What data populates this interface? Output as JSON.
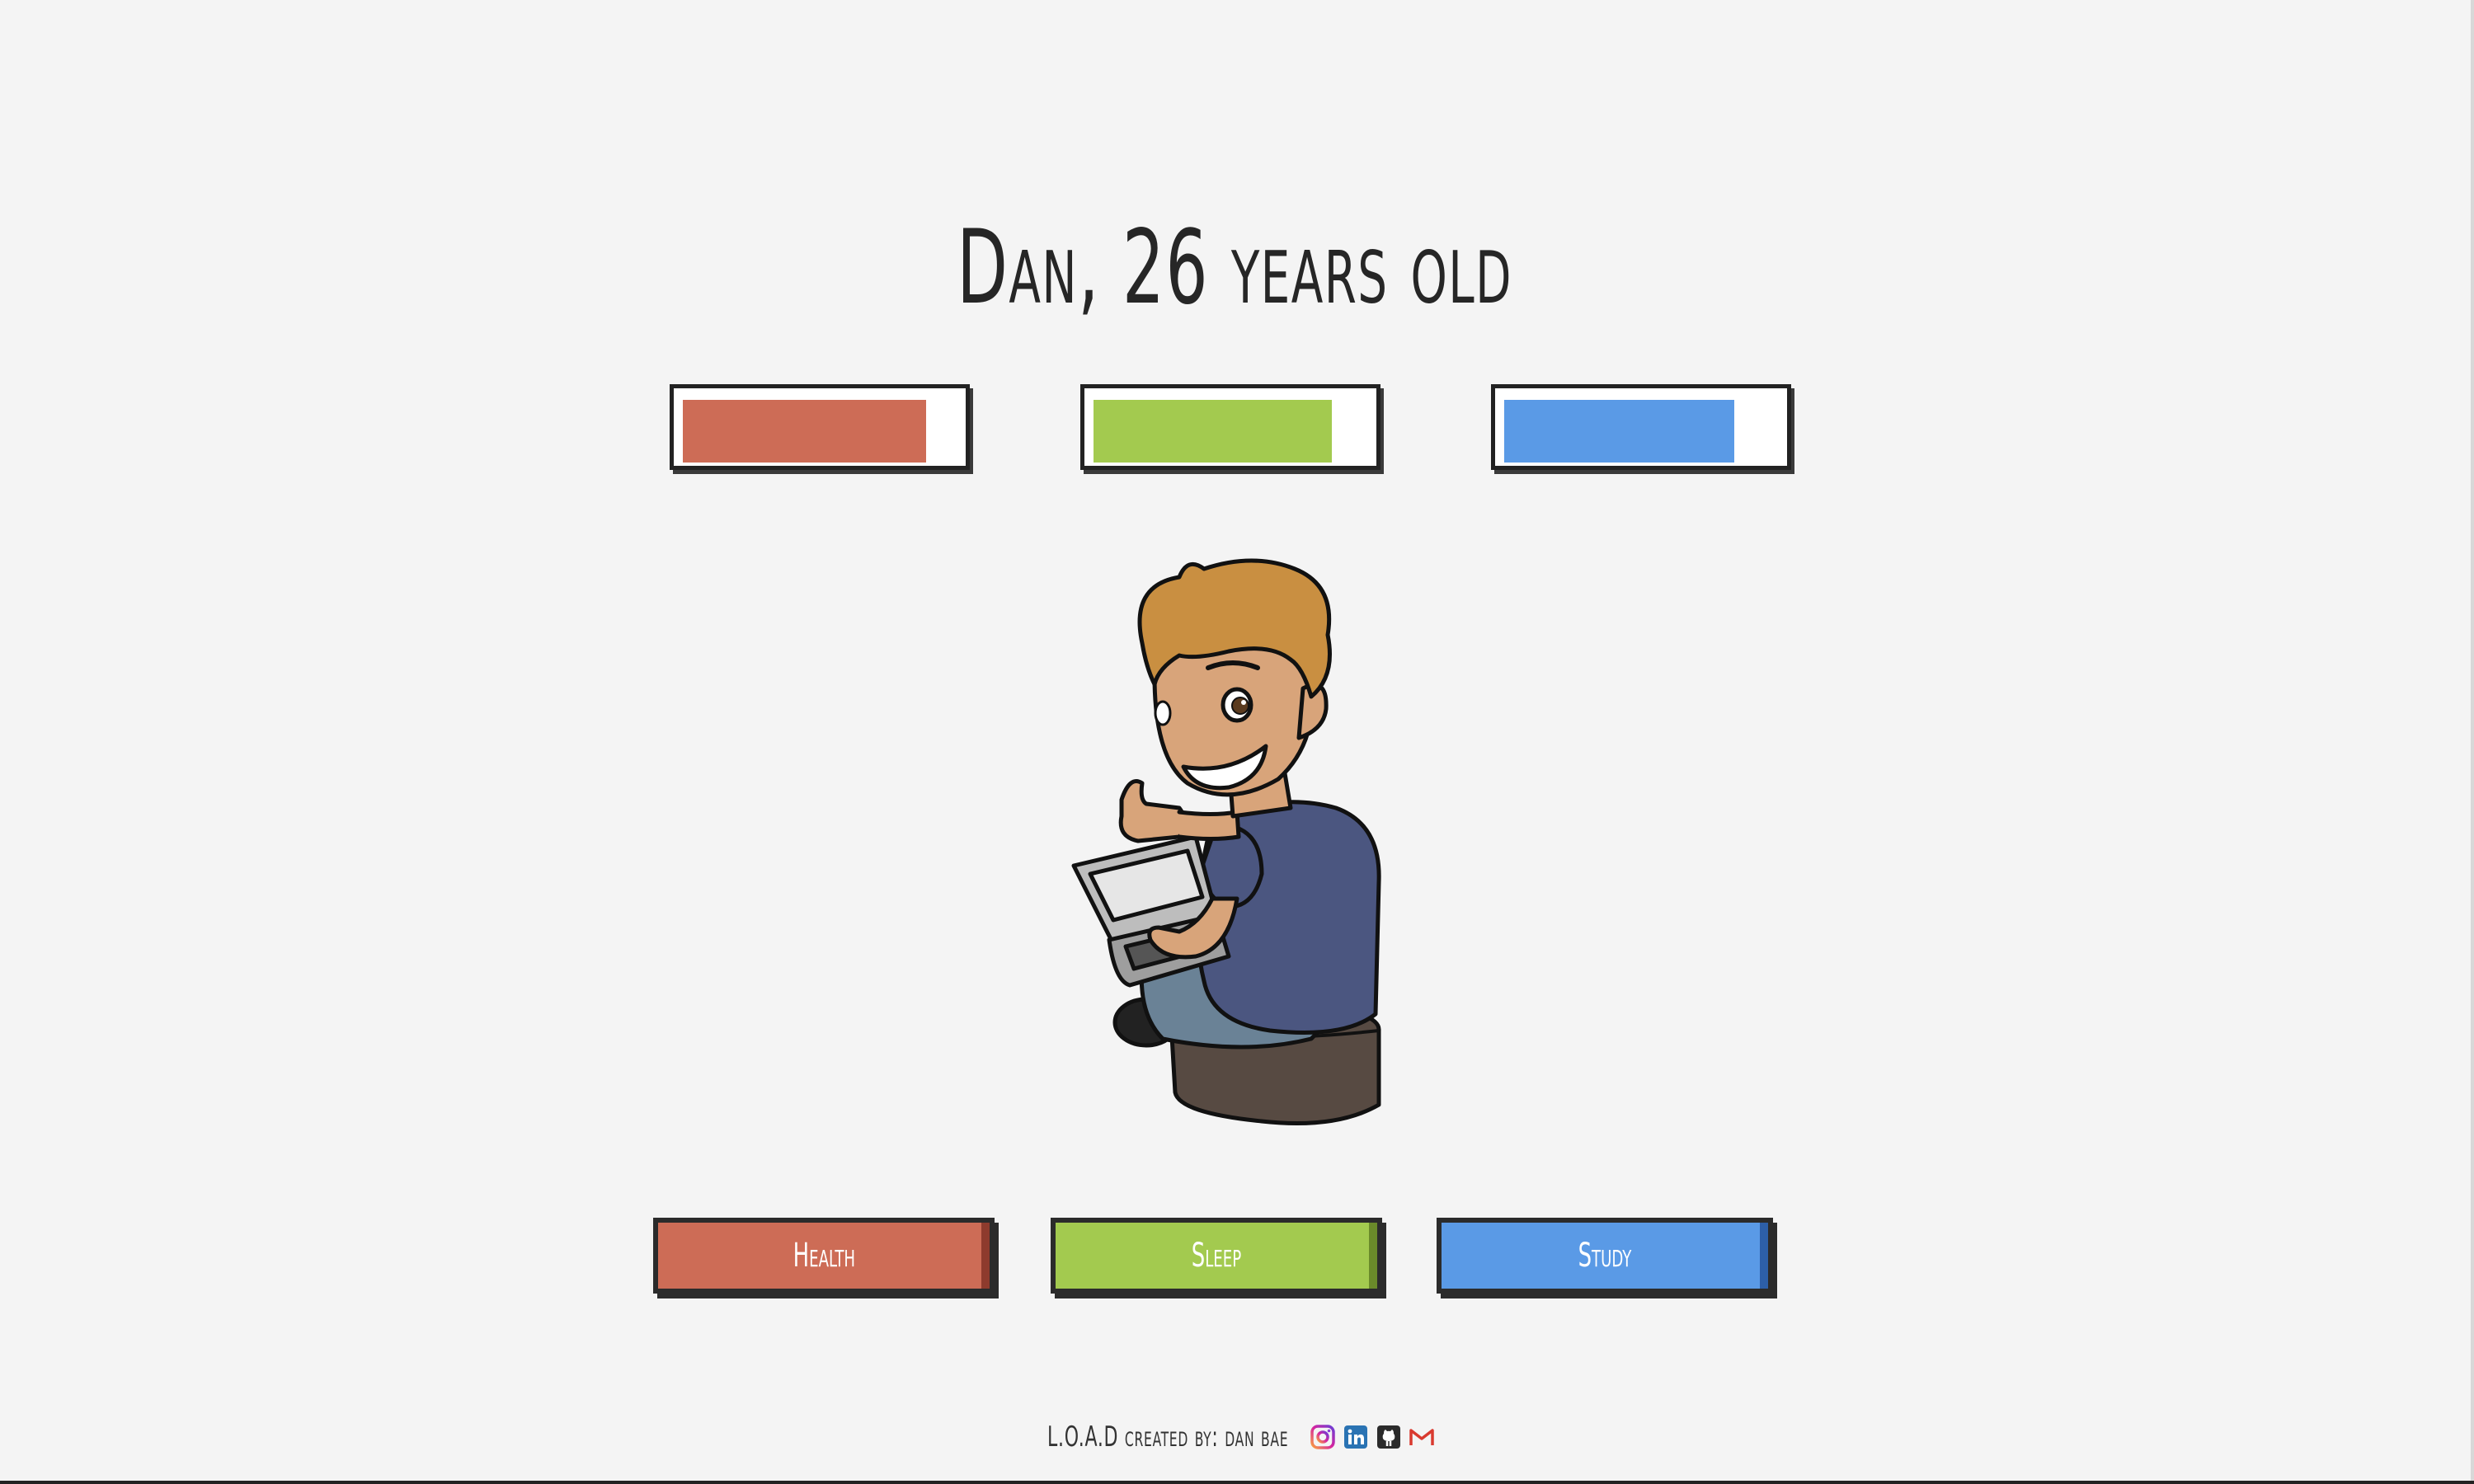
{
  "title": "Dan, 26 years old",
  "stats": [
    {
      "name": "health",
      "level": 0.89,
      "color": "#cd6c56"
    },
    {
      "name": "sleep",
      "level": 0.87,
      "color": "#a3ca4f"
    },
    {
      "name": "study",
      "level": 0.84,
      "color": "#5a9ae6"
    }
  ],
  "buttons": {
    "health": {
      "label": "Health",
      "color": "#cd6c56",
      "shade": "#8e3b2d"
    },
    "sleep": {
      "label": "Sleep",
      "color": "#a3ca4f",
      "shade": "#6a8a2a"
    },
    "study": {
      "label": "Study",
      "color": "#5a9ae6",
      "shade": "#2d5fa8"
    }
  },
  "footer": {
    "text": "L.O.A.D created by: dan bae",
    "icons": [
      "instagram-icon",
      "linkedin-icon",
      "github-icon",
      "gmail-icon"
    ]
  },
  "colors": {
    "background": "#f4f4f4",
    "outline": "#222222"
  }
}
